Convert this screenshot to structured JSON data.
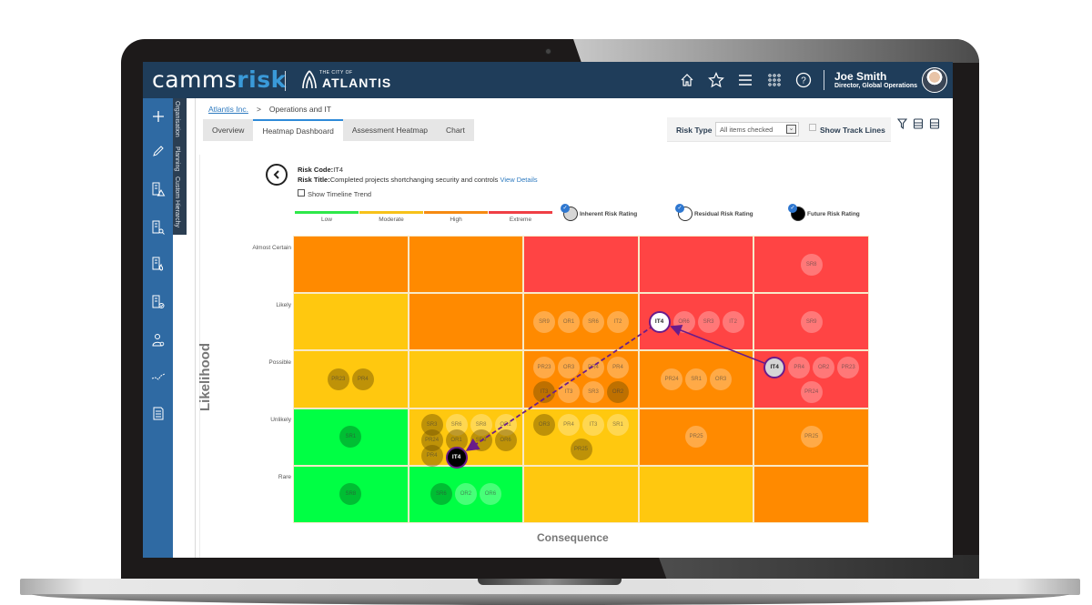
{
  "app": {
    "brand_prefix": "camms",
    "brand_suffix": "risk",
    "client_logo_small": "THE CITY OF",
    "client_logo_big": "ATLANTIS"
  },
  "topbar": {
    "icons": [
      "home-icon",
      "star-icon",
      "menu-icon",
      "apps-grid-icon",
      "help-icon"
    ],
    "user_name": "Joe Smith",
    "user_role": "Director, Global Operations"
  },
  "sidebar": {
    "icons": [
      "plus-icon",
      "pencil-icon",
      "document-warning-icon",
      "document-search-icon",
      "document-fire-icon",
      "document-check-icon",
      "user-search-icon",
      "trend-line-icon",
      "report-icon"
    ],
    "tabs": [
      "Organisation",
      "Planning",
      "Custom Hierarchy"
    ]
  },
  "breadcrumb": {
    "root": "Atlantis Inc.",
    "separator": ">",
    "current": "Operations and IT"
  },
  "tabs": [
    {
      "label": "Overview",
      "active": false
    },
    {
      "label": "Heatmap Dashboard",
      "active": true
    },
    {
      "label": "Assessment Heatmap",
      "active": false
    },
    {
      "label": "Chart",
      "active": false
    }
  ],
  "filters": {
    "risk_type_label": "Risk Type",
    "risk_type_value": "All items checked",
    "show_track_lines_label": "Show Track Lines",
    "show_track_lines_checked": false,
    "tool_icons": [
      "filter-icon",
      "print-icon",
      "export-icon"
    ]
  },
  "risk": {
    "code_label": "Risk Code:",
    "code": "IT4",
    "title_label": "Risk Title:",
    "title": "Completed projects shortchanging security and controls",
    "view_details": "View Details",
    "show_timeline_label": "Show Timeline Trend",
    "show_timeline_checked": false
  },
  "rating_scale": [
    {
      "label": "Low",
      "color": "#2ee84a"
    },
    {
      "label": "Moderate",
      "color": "#f7c21a"
    },
    {
      "label": "High",
      "color": "#f58a12"
    },
    {
      "label": "Extreme",
      "color": "#ef3f45"
    }
  ],
  "legend": [
    {
      "label": "Inherent Risk Rating",
      "checked": true
    },
    {
      "label": "Residual Risk Rating",
      "checked": true
    },
    {
      "label": "Future Risk Rating",
      "checked": true
    }
  ],
  "heatmap": {
    "x_axis_label": "Consequence",
    "y_axis_label": "Likelihood",
    "rows": [
      "Almost Certain",
      "Likely",
      "Possible",
      "Unlikely",
      "Rare"
    ],
    "colors": {
      "green": "#00ff44",
      "yellow": "#ffc80f",
      "orange": "#ff8a00",
      "red": "#ff4444"
    },
    "grid": [
      [
        "orange",
        "orange",
        "red",
        "red",
        "red"
      ],
      [
        "yellow",
        "orange",
        "orange",
        "red",
        "red"
      ],
      [
        "yellow",
        "yellow",
        "orange",
        "orange",
        "red"
      ],
      [
        "green",
        "yellow",
        "yellow",
        "orange",
        "orange"
      ],
      [
        "green",
        "green",
        "yellow",
        "yellow",
        "orange"
      ]
    ],
    "bubbles": [
      {
        "row": 0,
        "col": 4,
        "items": [
          {
            "code": "SR8",
            "shade": "light"
          }
        ]
      },
      {
        "row": 1,
        "col": 2,
        "items": [
          {
            "code": "SR9",
            "shade": "light"
          },
          {
            "code": "OR1",
            "shade": "light"
          },
          {
            "code": "SR6",
            "shade": "light"
          },
          {
            "code": "IT2",
            "shade": "light"
          }
        ]
      },
      {
        "row": 1,
        "col": 3,
        "items": [
          {
            "code": "OR6",
            "shade": "light"
          },
          {
            "code": "SR3",
            "shade": "light"
          },
          {
            "code": "IT2",
            "shade": "light"
          }
        ]
      },
      {
        "row": 1,
        "col": 4,
        "items": [
          {
            "code": "SR9",
            "shade": "light"
          }
        ]
      },
      {
        "row": 2,
        "col": 0,
        "items": [
          {
            "code": "PR23",
            "shade": "dark"
          },
          {
            "code": "PR4",
            "shade": "dark"
          }
        ]
      },
      {
        "row": 2,
        "col": 2,
        "items": [
          {
            "code": "PR23",
            "shade": "light"
          },
          {
            "code": "OR3",
            "shade": "light"
          },
          {
            "code": "PR4",
            "shade": "light"
          },
          {
            "code": "PR4",
            "shade": "light"
          },
          {
            "code": "IT3",
            "shade": "dark"
          },
          {
            "code": "IT3",
            "shade": "light"
          },
          {
            "code": "SR3",
            "shade": "light"
          },
          {
            "code": "OR2",
            "shade": "dark"
          }
        ]
      },
      {
        "row": 2,
        "col": 3,
        "items": [
          {
            "code": "PR24",
            "shade": "light"
          },
          {
            "code": "SR1",
            "shade": "light"
          },
          {
            "code": "OR3",
            "shade": "light"
          }
        ]
      },
      {
        "row": 2,
        "col": 4,
        "items": [
          {
            "code": "PR4",
            "shade": "light"
          },
          {
            "code": "OR2",
            "shade": "light"
          },
          {
            "code": "PR23",
            "shade": "light"
          },
          {
            "code": "PR24",
            "shade": "light"
          }
        ]
      },
      {
        "row": 3,
        "col": 0,
        "items": [
          {
            "code": "SR1",
            "shade": "green-dark"
          }
        ]
      },
      {
        "row": 3,
        "col": 1,
        "items": [
          {
            "code": "SR3",
            "shade": "dark"
          },
          {
            "code": "SR6",
            "shade": "light"
          },
          {
            "code": "SR8",
            "shade": "light"
          },
          {
            "code": "OR1",
            "shade": "light"
          },
          {
            "code": "PR24",
            "shade": "dark"
          },
          {
            "code": "OR1",
            "shade": "dark"
          },
          {
            "code": "SR9",
            "shade": "dark"
          },
          {
            "code": "OR6",
            "shade": "dark"
          },
          {
            "code": "PR4",
            "shade": "dark"
          }
        ]
      },
      {
        "row": 3,
        "col": 2,
        "items": [
          {
            "code": "OR3",
            "shade": "dark"
          },
          {
            "code": "PR4",
            "shade": "light"
          },
          {
            "code": "IT3",
            "shade": "light"
          },
          {
            "code": "SR1",
            "shade": "light"
          },
          {
            "code": "PR25",
            "shade": "dark"
          }
        ]
      },
      {
        "row": 3,
        "col": 3,
        "items": [
          {
            "code": "PR25",
            "shade": "light"
          }
        ]
      },
      {
        "row": 3,
        "col": 4,
        "items": [
          {
            "code": "PR25",
            "shade": "light"
          }
        ]
      },
      {
        "row": 4,
        "col": 0,
        "items": [
          {
            "code": "SR8",
            "shade": "green-dark"
          }
        ]
      },
      {
        "row": 4,
        "col": 1,
        "items": [
          {
            "code": "SR6",
            "shade": "green-dark"
          },
          {
            "code": "OR2",
            "shade": "green-light"
          },
          {
            "code": "OR6",
            "shade": "green-light"
          }
        ]
      }
    ],
    "focus_risk": {
      "code": "IT4",
      "inherent": {
        "row": 2,
        "col": 4
      },
      "residual": {
        "row": 1,
        "col": 3
      },
      "future": {
        "row": 3,
        "col": 1
      }
    },
    "track_color": "#6a1c8a"
  }
}
